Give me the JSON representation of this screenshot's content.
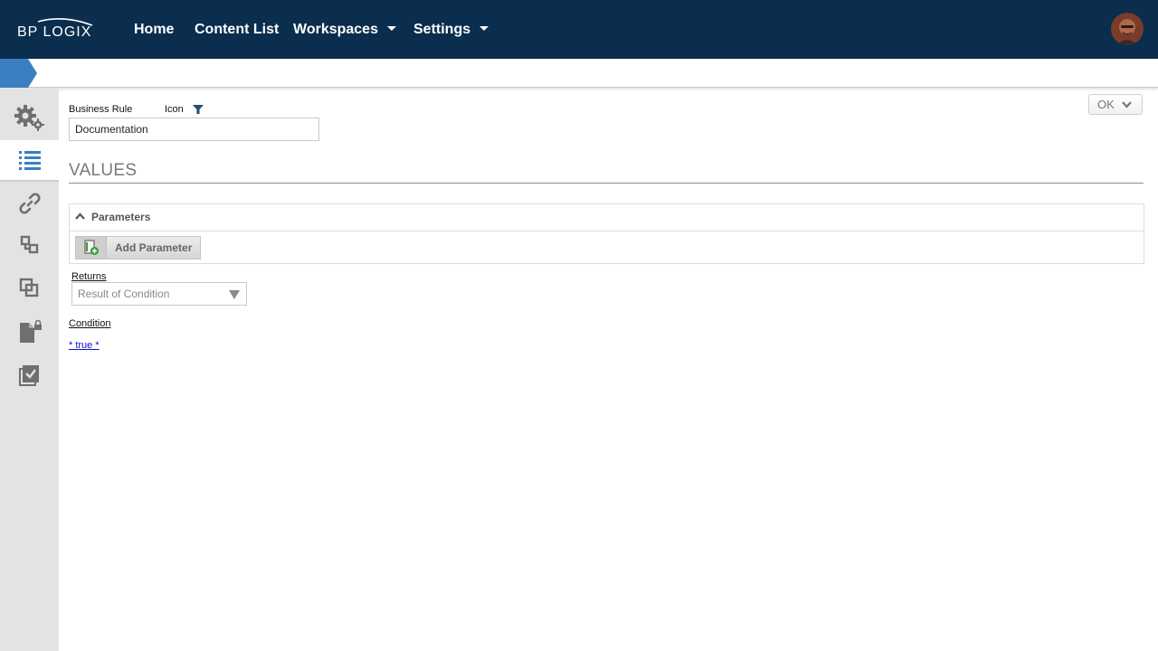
{
  "brand": {
    "logo_text": "BP LOGIX"
  },
  "nav": {
    "home": "Home",
    "content_list": "Content List",
    "workspaces": "Workspaces",
    "settings": "Settings"
  },
  "rail": {
    "items": [
      "gears-icon",
      "list-icon",
      "link-icon",
      "relation-icon",
      "copy-icon",
      "locked-document-icon",
      "checklist-icon"
    ],
    "active_index": 1
  },
  "form": {
    "business_rule_label": "Business Rule",
    "icon_label": "Icon",
    "name_value": "Documentation",
    "ok_label": "OK"
  },
  "values": {
    "section_title": "VALUES",
    "parameters_title": "Parameters",
    "add_parameter_label": "Add Parameter",
    "returns_label": "Returns",
    "returns_selected": "Result of Condition",
    "condition_label": "Condition",
    "condition_value": "* true *"
  },
  "colors": {
    "topbar": "#0b2d4e",
    "accent": "#3a7fc1",
    "rail": "#e3e3e3"
  }
}
